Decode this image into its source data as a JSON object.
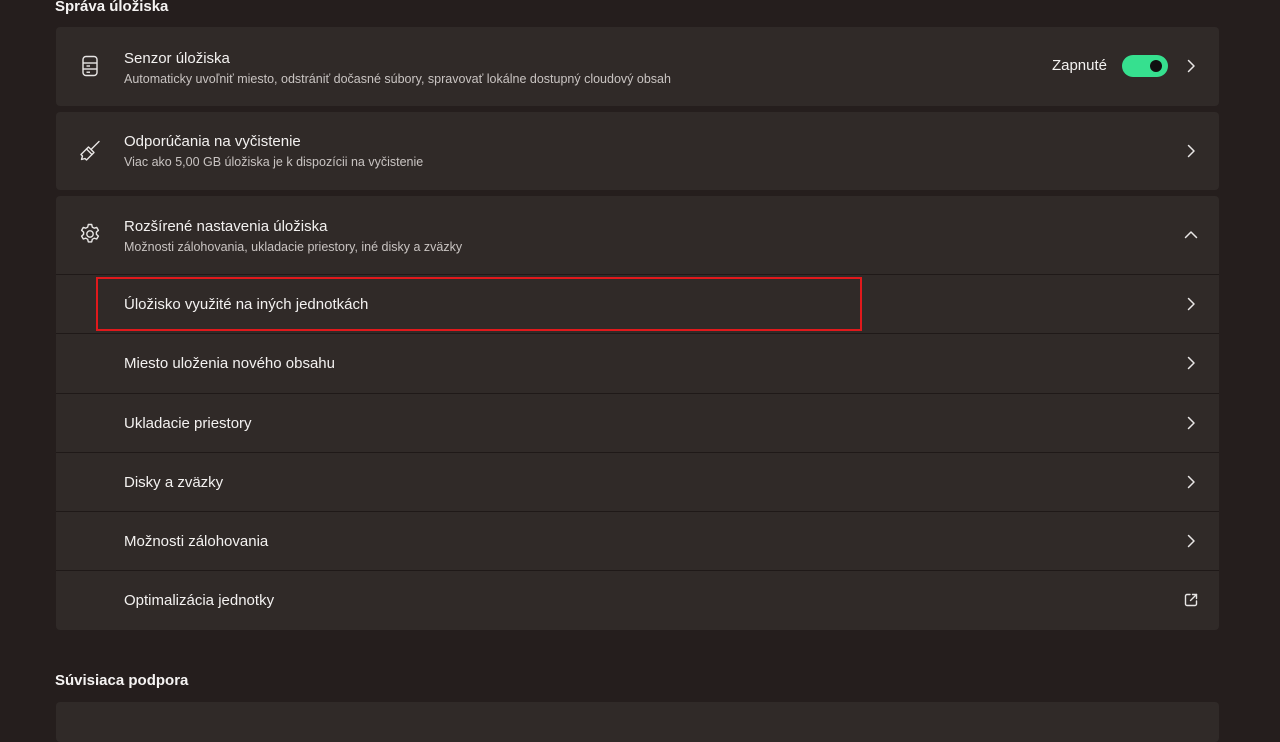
{
  "sections": {
    "storage_management": "Správa úložiska",
    "related_support": "Súvisiaca podpora"
  },
  "storage_sense": {
    "title": "Senzor úložiska",
    "description": "Automaticky uvoľniť miesto, odstrániť dočasné súbory, spravovať lokálne dostupný cloudový obsah",
    "toggle_label": "Zapnuté",
    "toggle_on": true,
    "icon": "storage-drive-icon"
  },
  "cleanup": {
    "title": "Odporúčania na vyčistenie",
    "description": "Viac ako 5,00 GB úložiska je k dispozícii na vyčistenie",
    "icon": "broom-icon"
  },
  "advanced": {
    "title": "Rozšírené nastavenia úložiska",
    "description": "Možnosti zálohovania, ukladacie priestory, iné disky a zväzky",
    "icon": "gear-icon",
    "expanded": true,
    "items": [
      {
        "label": "Úložisko využité na iných jednotkách",
        "icon": "chevron-right-icon",
        "highlighted": true
      },
      {
        "label": "Miesto uloženia nového obsahu",
        "icon": "chevron-right-icon"
      },
      {
        "label": "Ukladacie priestory",
        "icon": "chevron-right-icon"
      },
      {
        "label": "Disky a zväzky",
        "icon": "chevron-right-icon"
      },
      {
        "label": "Možnosti zálohovania",
        "icon": "chevron-right-icon"
      },
      {
        "label": "Optimalizácia jednotky",
        "icon": "external-link-icon"
      }
    ]
  },
  "colors": {
    "background": "#251e1d",
    "card": "#302a28",
    "toggle_on": "#36e08f",
    "highlight": "#e0191c"
  }
}
